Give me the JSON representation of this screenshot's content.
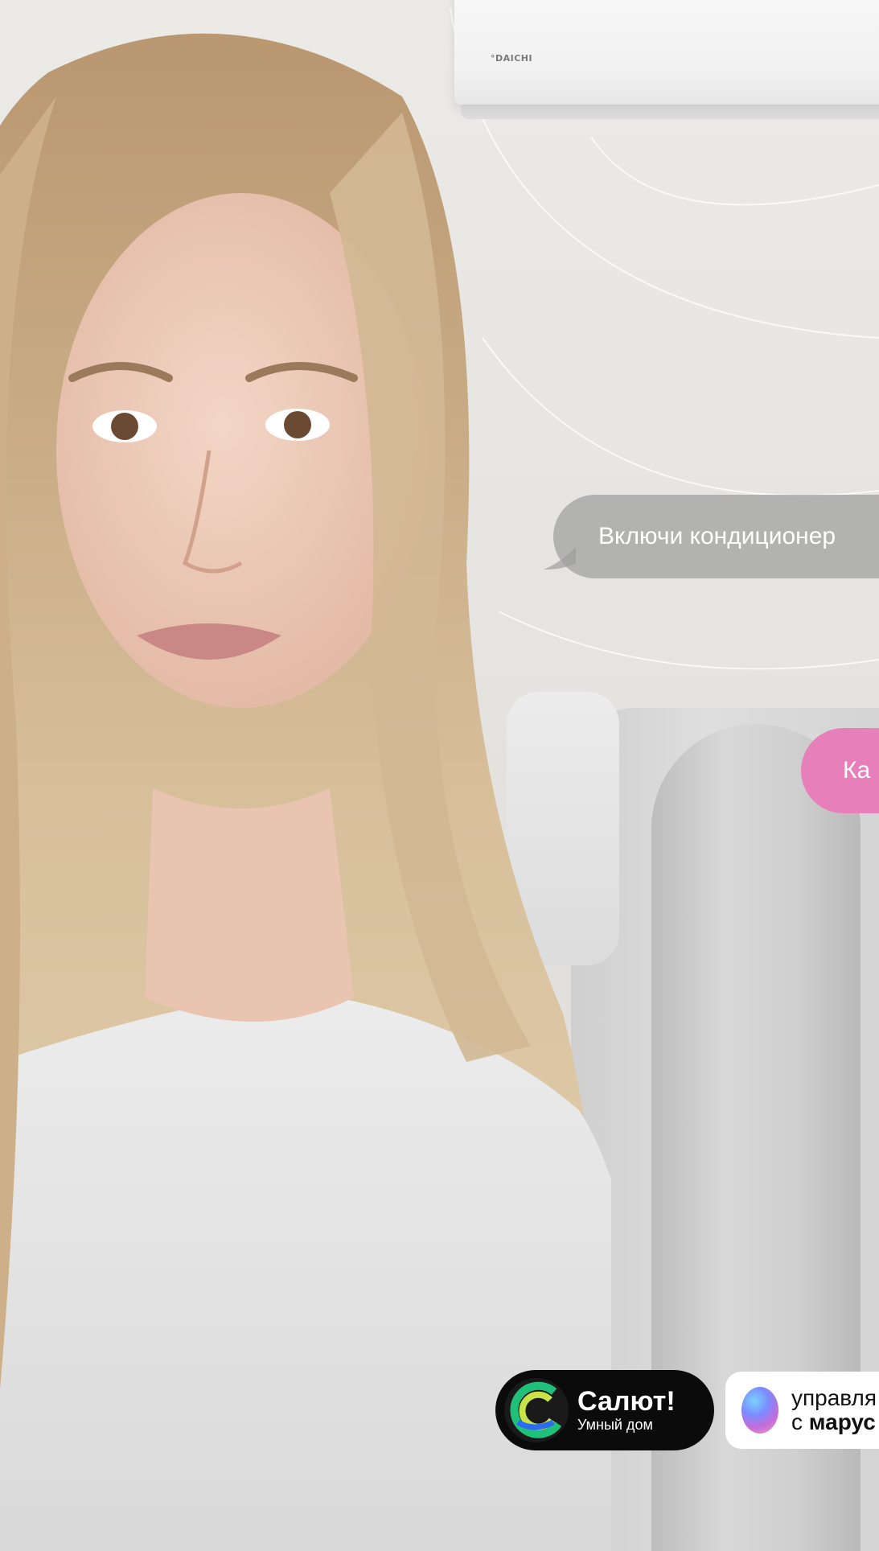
{
  "ac": {
    "brand": "°DAICHI"
  },
  "chat": {
    "user_message": "Включи кондиционер",
    "assistant_message": "Ка"
  },
  "badges": {
    "salut": {
      "title": "Салют!",
      "subtitle": "Умный дом"
    },
    "marusia": {
      "line1": "управля",
      "line2_prefix": "с ",
      "line2_brand": "марус"
    }
  },
  "colors": {
    "assistant_bubble": "#e77fba",
    "user_bubble": "#9e9e9e",
    "salut_badge": "#0b0b0b"
  }
}
